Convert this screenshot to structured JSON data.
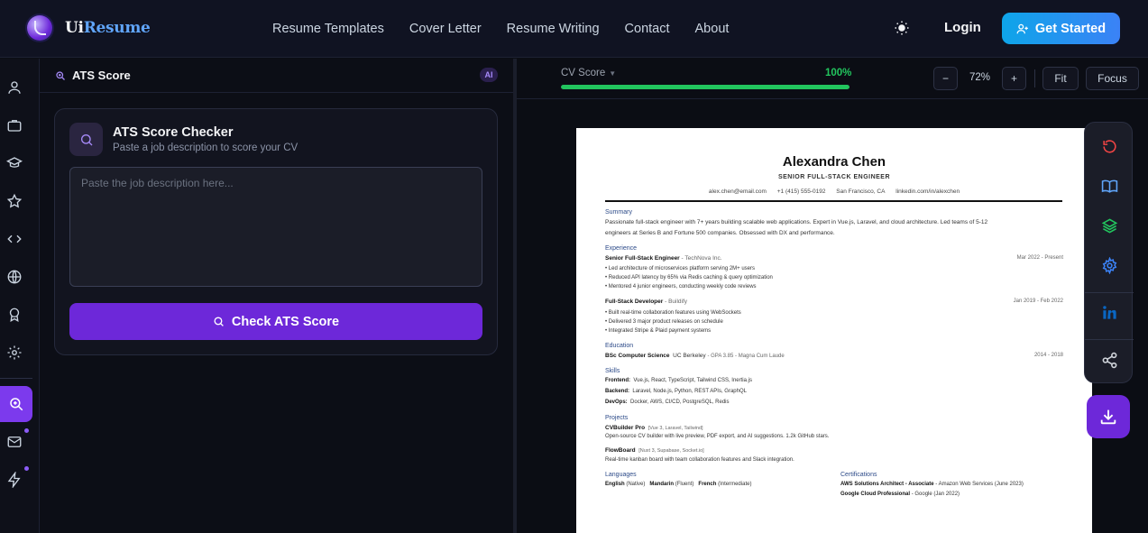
{
  "brand": {
    "name_part1": "Ui",
    "name_part2": "Resume"
  },
  "nav": {
    "links": [
      "Resume Templates",
      "Cover Letter",
      "Resume Writing",
      "Contact",
      "About"
    ],
    "login": "Login",
    "cta": "Get Started"
  },
  "rail": {
    "icons": [
      "user-icon",
      "briefcase-icon",
      "graduation-cap-icon",
      "star-icon",
      "code-icon",
      "globe-icon",
      "award-icon",
      "gear-icon",
      "search-zoom-icon",
      "mail-icon",
      "lightning-icon"
    ],
    "active": "search-zoom-icon"
  },
  "panel": {
    "header_title": "ATS Score",
    "badge": "AI",
    "card_title": "ATS Score Checker",
    "card_subtitle": "Paste a job description to score your CV",
    "textarea_placeholder": "Paste the job description here...",
    "button_label": "Check ATS Score"
  },
  "toolbar": {
    "score_label": "CV Score",
    "score_value": "100%",
    "score_fraction": 1.0,
    "zoom_out": "−",
    "zoom_level": "72%",
    "zoom_in": "+",
    "fit": "Fit",
    "focus": "Focus"
  },
  "resume": {
    "name": "Alexandra Chen",
    "role": "SENIOR FULL-STACK ENGINEER",
    "email": "alex.chen@email.com",
    "phone": "+1 (415) 555-0192",
    "location": "San Francisco, CA",
    "linkedin": "linkedin.com/in/alexchen",
    "summary_heading": "Summary",
    "summary_line1": "Passionate full-stack engineer with 7+ years building scalable web applications. Expert in Vue.js, Laravel, and cloud architecture. Led teams of 5-12",
    "summary_line2": "engineers at Series B and Fortune 500 companies. Obsessed with DX and performance.",
    "experience_heading": "Experience",
    "jobs": [
      {
        "title": "Senior Full-Stack Engineer",
        "company": "- TechNova Inc.",
        "dates": "Mar 2022 - Present",
        "bullets": [
          "• Led architecture of microservices platform serving 2M+ users",
          "• Reduced API latency by 65% via Redis caching & query optimization",
          "• Mentored 4 junior engineers, conducting weekly code reviews"
        ]
      },
      {
        "title": "Full-Stack Developer",
        "company": "- Buildify",
        "dates": "Jan 2019 - Feb 2022",
        "bullets": [
          "• Built real-time collaboration features using WebSockets",
          "• Delivered 3 major product releases on schedule",
          "• Integrated Stripe & Plaid payment systems"
        ]
      }
    ],
    "education_heading": "Education",
    "degree": "BSc Computer Science",
    "school": "UC Berkeley",
    "gpa": "- GPA 3.85 - Magna Cum Laude",
    "edu_dates": "2014 - 2018",
    "skills_heading": "Skills",
    "skills": [
      {
        "label": "Frontend:",
        "value": "Vue.js, React, TypeScript, Tailwind CSS, Inertia.js"
      },
      {
        "label": "Backend:",
        "value": "Laravel, Node.js, Python, REST APIs, GraphQL"
      },
      {
        "label": "DevOps:",
        "value": "Docker, AWS, CI/CD, PostgreSQL, Redis"
      }
    ],
    "projects_heading": "Projects",
    "projects": [
      {
        "name": "CVBuilder Pro",
        "stack": "[Vue 3, Laravel, Tailwind]",
        "desc": "Open-source CV builder with live preview, PDF export, and AI suggestions. 1.2k GitHub stars."
      },
      {
        "name": "FlowBoard",
        "stack": "[Nuxt 3, Supabase, Socket.io]",
        "desc": "Real-time kanban board with team collaboration features and Slack integration."
      }
    ],
    "languages_heading": "Languages",
    "languages": [
      {
        "name": "English",
        "level": "(Native)"
      },
      {
        "name": "Mandarin",
        "level": "(Fluent)"
      },
      {
        "name": "French",
        "level": "(Intermediate)"
      }
    ],
    "certs_heading": "Certifications",
    "certs": [
      {
        "name": "AWS Solutions Architect - Associate",
        "detail": "- Amazon Web Services (June 2023)"
      },
      {
        "name": "Google Cloud Professional",
        "detail": "- Google (Jan 2022)"
      }
    ]
  },
  "tools": [
    "undo-icon",
    "book-icon",
    "layers-icon",
    "gear-icon",
    "linkedin-icon",
    "share-icon"
  ],
  "colors": {
    "accent": "#6d28d9",
    "cta": "#3b82f6",
    "score": "#22c55e"
  }
}
